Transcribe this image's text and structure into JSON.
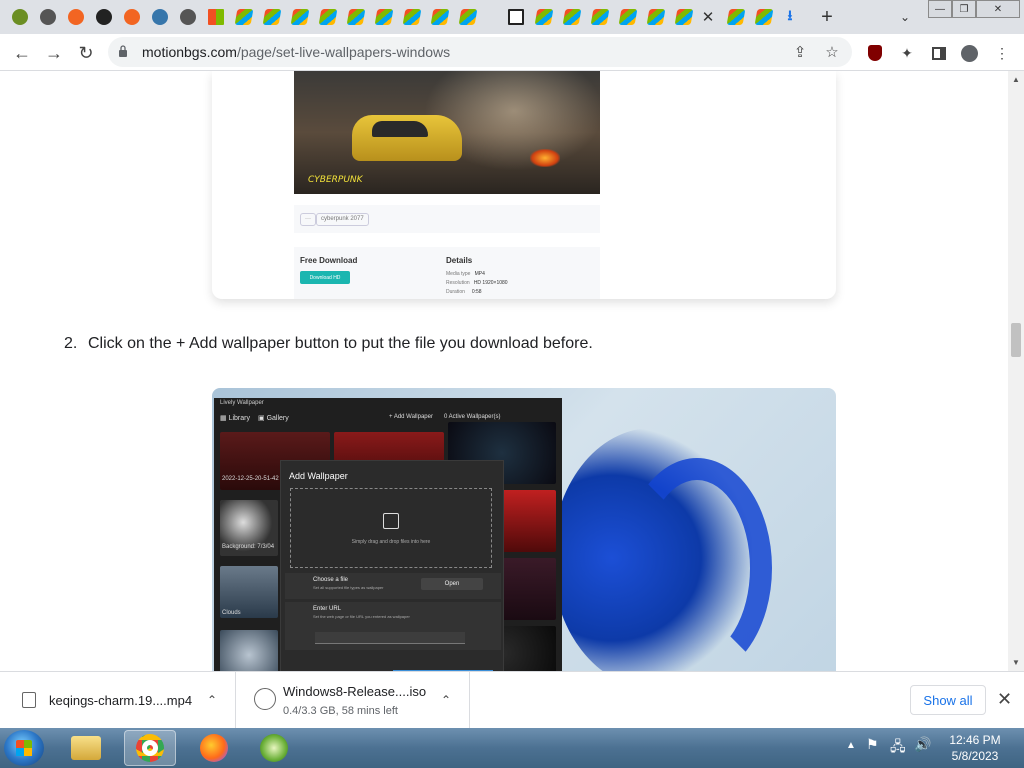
{
  "browser": {
    "tabs": [
      {
        "icon": "leaf-favicon",
        "color": "#6b8e23"
      },
      {
        "icon": "globe-favicon",
        "color": "#555555"
      },
      {
        "icon": "gear-favicon",
        "color": "#f26522"
      },
      {
        "icon": "github-favicon",
        "color": "#222222"
      },
      {
        "icon": "gear-favicon",
        "color": "#f26522"
      },
      {
        "icon": "python-favicon",
        "color": "#3776ab"
      },
      {
        "icon": "globe-favicon",
        "color": "#555555"
      },
      {
        "icon": "windows-favicon",
        "color": "#00a4ef"
      },
      {
        "icon": "windows-flag-favicon",
        "color": "#e8b030"
      },
      {
        "icon": "windows-flag-favicon",
        "color": "#e8b030"
      },
      {
        "icon": "windows-flag-favicon",
        "color": "#e8b030"
      },
      {
        "icon": "windows-flag-favicon",
        "color": "#e8b030"
      },
      {
        "icon": "windows-flag-favicon",
        "color": "#e8b030"
      },
      {
        "icon": "windows-flag-favicon",
        "color": "#e8b030"
      },
      {
        "icon": "windows-flag-favicon",
        "color": "#e8b030"
      },
      {
        "icon": "windows-flag-favicon",
        "color": "#e8b030"
      },
      {
        "icon": "windows-flag-favicon",
        "color": "#e8b030"
      },
      {
        "icon": "archive-favicon",
        "color": "#222222"
      },
      {
        "icon": "windows-flag-favicon",
        "color": "#e8b030"
      },
      {
        "icon": "windows-flag-favicon",
        "color": "#e8b030"
      },
      {
        "icon": "windows-flag-favicon",
        "color": "#e8b030"
      },
      {
        "icon": "windows-flag-favicon",
        "color": "#e8b030"
      },
      {
        "icon": "windows-flag-favicon",
        "color": "#e8b030"
      },
      {
        "icon": "windows-flag-favicon",
        "color": "#e8b030"
      },
      {
        "icon": "windows-flag-favicon",
        "color": "#e8b030"
      },
      {
        "icon": "windows-flag-favicon",
        "color": "#e8b030"
      },
      {
        "icon": "download-favicon",
        "color": "#1a73e8"
      }
    ],
    "url_host": "motionbgs.com",
    "url_path": "/page/set-live-wallpapers-windows"
  },
  "page": {
    "card1": {
      "hero_logo": "CYBERPUNK",
      "chips": [
        "···",
        "cyberpunk 2077"
      ],
      "free_download_title": "Free Download",
      "download_btn": "Download HD",
      "details_title": "Details",
      "details": [
        {
          "k": "Media type",
          "v": "MP4"
        },
        {
          "k": "Resolution",
          "v": "HD 1920×1080"
        },
        {
          "k": "Duration",
          "v": "0:58"
        }
      ]
    },
    "step2": {
      "number": "2.",
      "text": "Click on the + Add wallpaper button to put the file you download before."
    },
    "screenshot2": {
      "window_title": "Lively Wallpaper",
      "nav_library": "Library",
      "nav_gallery": "Gallery",
      "add_wallpaper": "+  Add Wallpaper",
      "active_wallpapers": "0 Active Wallpaper(s)",
      "captions": [
        "2022-12-25-20-51-42",
        "Background: 7/3/04",
        "Clouds"
      ],
      "dialog": {
        "title": "Add Wallpaper",
        "drop_text": "Simply drag and drop files into here",
        "choose_title": "Choose a file",
        "choose_sub": "Set all supported file types as wallpaper",
        "open_btn": "Open",
        "url_title": "Enter URL",
        "url_sub": "Set the web page or file URL you entered as wallpaper"
      }
    }
  },
  "downloads": [
    {
      "name": "keqings-charm.19....mp4",
      "status": ""
    },
    {
      "name": "Windows8-Release....iso",
      "status": "0.4/3.3 GB, 58 mins left"
    }
  ],
  "show_all": "Show all",
  "taskbar": {
    "time": "12:46 PM",
    "date": "5/8/2023"
  }
}
